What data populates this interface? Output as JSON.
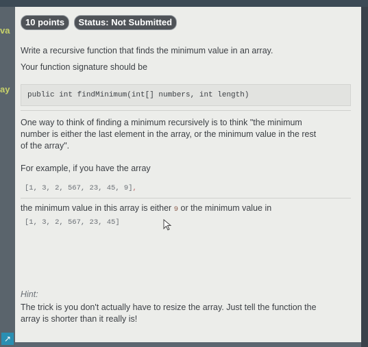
{
  "side_fragments": [
    "va",
    "ay"
  ],
  "header": {
    "points": "10 points",
    "status": "Status: Not Submitted"
  },
  "prompt": {
    "line1": "Write a recursive function that finds the minimum value in an array.",
    "line2": "Your function signature should be",
    "signature": "public int findMinimum(int[] numbers, int length)",
    "para1": "One way to think of finding a minimum recursively is to think \"the minimum number is either the last element in the array, or the minimum value in the rest of the array\".",
    "para1_l1": "One way to think of finding a minimum recursively is to think \"the minimum",
    "para1_l2": "number is either the last element in the array, or the minimum value in the rest",
    "para1_l3": "of the array\".",
    "example_intro": "For example, if you have the array",
    "example_array": "[1, 3, 2, 567, 23, 45, 9]",
    "example_comma": ",",
    "min_text_a": "the minimum value in this array is either ",
    "min_value": "9",
    "min_text_b": " or the minimum value in",
    "rest_array": "[1, 3, 2, 567, 23, 45]"
  },
  "hint": {
    "label": "Hint:",
    "line1": "The trick is you don't actually have to resize the array. Just tell the function the",
    "line2": "array is shorter than it really is!"
  },
  "colors": {
    "panel_bg": "#ecedea",
    "badge_bg": "#4f5358",
    "text": "#3b3f44"
  },
  "icons": {
    "corner": "expand-icon",
    "cursor": "mouse-pointer-icon"
  }
}
